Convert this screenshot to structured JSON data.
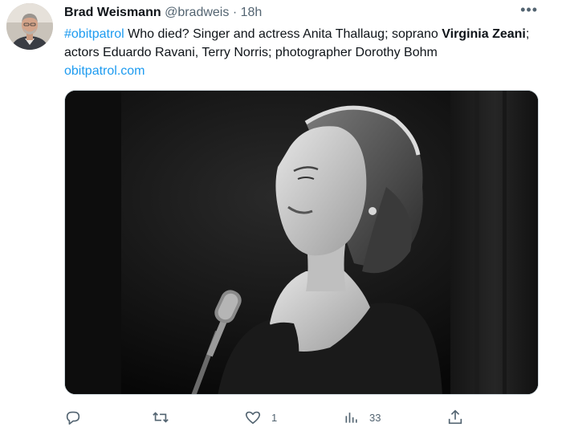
{
  "tweet": {
    "author_name": "Brad Weismann",
    "handle": "@bradweis",
    "separator": "·",
    "time": "18h",
    "more_label": "•••",
    "text": {
      "hashtag": "#obitpatrol",
      "part1": " Who died? Singer and actress Anita Thallaug; soprano ",
      "bold1": "Virginia Zeani",
      "part2": "; actors Eduardo Ravani, Terry Norris; photographer Dorothy Bohm",
      "link": "obitpatrol.com"
    },
    "media": {
      "icon": "photo-of-singer-at-microphone"
    },
    "actions": {
      "reply": {
        "icon": "reply-icon",
        "count": ""
      },
      "retweet": {
        "icon": "retweet-icon",
        "count": ""
      },
      "like": {
        "icon": "heart-icon",
        "count": "1"
      },
      "views": {
        "icon": "analytics-icon",
        "count": "33"
      },
      "share": {
        "icon": "share-icon",
        "count": ""
      }
    },
    "colors": {
      "link": "#1d9bf0",
      "secondary_text": "#536471",
      "primary_text": "#0f1419"
    }
  }
}
